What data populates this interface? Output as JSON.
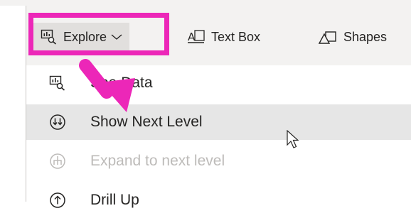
{
  "toolbar": {
    "explore_label": "Explore",
    "textbox_label": "Text Box",
    "shapes_label": "Shapes"
  },
  "menu": {
    "items": [
      {
        "label": "See Data",
        "icon": "see-data-icon",
        "state": "normal"
      },
      {
        "label": "Show Next Level",
        "icon": "show-next-level-icon",
        "state": "hover"
      },
      {
        "label": "Expand to next level",
        "icon": "expand-next-level-icon",
        "state": "disabled"
      },
      {
        "label": "Drill Up",
        "icon": "drill-up-icon",
        "state": "normal"
      }
    ]
  },
  "colors": {
    "highlight": "#ec27b8",
    "ribbon_bg": "#f3f2f1",
    "hover_bg": "#e6e6e6",
    "disabled_text": "#bdbbb9"
  }
}
